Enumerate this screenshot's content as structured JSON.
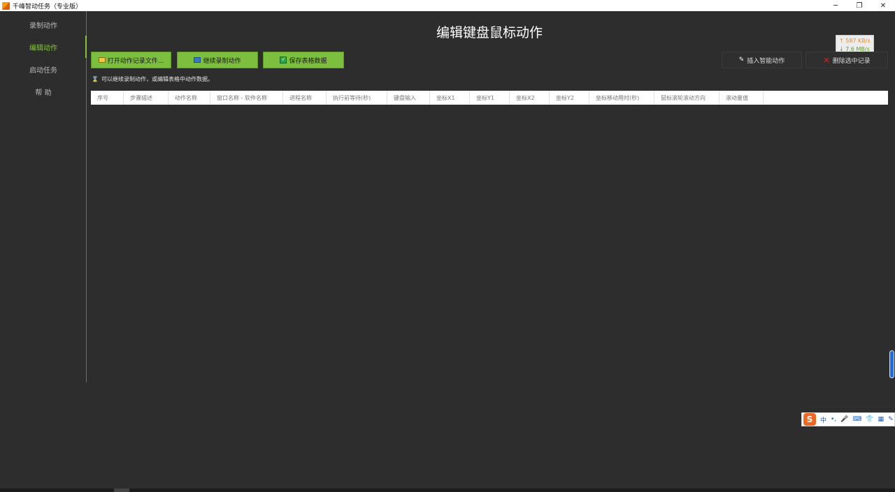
{
  "window": {
    "title": "千峰智动任务（专业版）",
    "min_glyph": "─",
    "restore_glyph": "❐",
    "close_glyph": "✕"
  },
  "sidebar": {
    "items": [
      {
        "label": "录制动作",
        "active": false
      },
      {
        "label": "编辑动作",
        "active": true
      },
      {
        "label": "启动任务",
        "active": false
      },
      {
        "label": "帮 助",
        "active": false
      }
    ]
  },
  "page": {
    "title": "编辑键盘鼠标动作",
    "hint": "可以继续录制动作，或编辑表格中动作数据。"
  },
  "toolbar": {
    "open_label": "打开动作记录文件...",
    "continue_label": "继续录制动作",
    "save_label": "保存表格数据",
    "insert_label": "插入智能动作",
    "delete_label": "删除选中记录"
  },
  "net_monitor": {
    "up": "↑ 587 KB/s",
    "down": "↓ 7.6 MB/s"
  },
  "table": {
    "columns": [
      {
        "label": "序号",
        "w": 47
      },
      {
        "label": "步骤描述",
        "w": 64
      },
      {
        "label": "动作名称",
        "w": 60
      },
      {
        "label": "窗口名称 - 软件名称",
        "w": 104
      },
      {
        "label": "进程名称",
        "w": 62
      },
      {
        "label": "执行前等待(秒)",
        "w": 87
      },
      {
        "label": "键盘输入",
        "w": 61
      },
      {
        "label": "坐标X1",
        "w": 57
      },
      {
        "label": "坐标Y1",
        "w": 57
      },
      {
        "label": "坐标X2",
        "w": 57
      },
      {
        "label": "坐标Y2",
        "w": 57
      },
      {
        "label": "坐标移动用时(秒)",
        "w": 93
      },
      {
        "label": "鼠标滚轮滚动方向",
        "w": 93
      },
      {
        "label": "滚动量值",
        "w": 63
      }
    ]
  },
  "ime": {
    "logo": "S",
    "lang": "中",
    "items": [
      "•,",
      "🎤",
      "⌨",
      "👕",
      "▦",
      "✎"
    ]
  }
}
